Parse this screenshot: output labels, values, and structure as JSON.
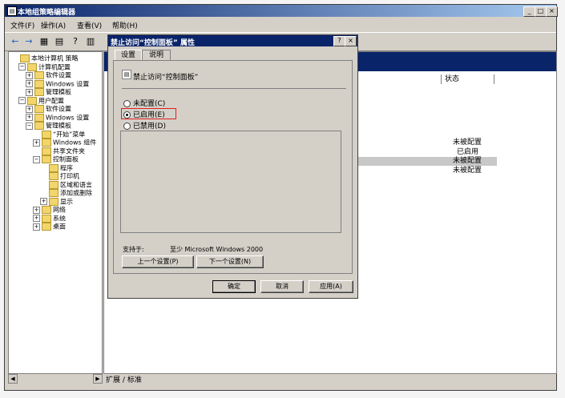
{
  "window": {
    "title": "本地组策略编辑器",
    "controls": [
      "_",
      "□",
      "×"
    ]
  },
  "menu": [
    "文件(F)",
    "操作(A)",
    "查看(V)",
    "帮助(H)"
  ],
  "toolbar": [
    "←",
    "→",
    "▦",
    "▤",
    "?",
    "▥"
  ],
  "tree": [
    {
      "label": "本地计算机 策略",
      "indent": 0,
      "exp": ""
    },
    {
      "label": "计算机配置",
      "indent": 1,
      "exp": "−"
    },
    {
      "label": "软件设置",
      "indent": 2,
      "exp": "+"
    },
    {
      "label": "Windows 设置",
      "indent": 2,
      "exp": "+"
    },
    {
      "label": "管理模板",
      "indent": 2,
      "exp": "+"
    },
    {
      "label": "用户配置",
      "indent": 1,
      "exp": "−"
    },
    {
      "label": "软件设置",
      "indent": 2,
      "exp": "+"
    },
    {
      "label": "Windows 设置",
      "indent": 2,
      "exp": "+"
    },
    {
      "label": "管理模板",
      "indent": 2,
      "exp": "−"
    },
    {
      "label": "“开始”菜单",
      "indent": 3,
      "exp": ""
    },
    {
      "label": "Windows 组件",
      "indent": 3,
      "exp": "+"
    },
    {
      "label": "共享文件夹",
      "indent": 3,
      "exp": ""
    },
    {
      "label": "控制面板",
      "indent": 3,
      "exp": "−"
    },
    {
      "label": "程序",
      "indent": 4,
      "exp": ""
    },
    {
      "label": "打印机",
      "indent": 4,
      "exp": ""
    },
    {
      "label": "区域和语言",
      "indent": 4,
      "exp": ""
    },
    {
      "label": "添加或删除",
      "indent": 4,
      "exp": ""
    },
    {
      "label": "显示",
      "indent": 4,
      "exp": "+"
    },
    {
      "label": "网络",
      "indent": 3,
      "exp": "+"
    },
    {
      "label": "系统",
      "indent": 3,
      "exp": "+"
    },
    {
      "label": "桌面",
      "indent": 3,
      "exp": "+"
    }
  ],
  "right": {
    "column_header": "状态",
    "statuses": [
      "未被配置",
      "已启用",
      "未被配置",
      "未被配置"
    ]
  },
  "bottom_tabs": {
    "extend": "扩展",
    "standard": "标准"
  },
  "dialog": {
    "title": "禁止访问“控制面板” 属性",
    "help_btn": "?",
    "close_btn": "×",
    "tab_settings": "设置",
    "tab_explain": "说明",
    "policy_name": "禁止访问“控制面板”",
    "opt_not_configured": "未配置(C)",
    "opt_enabled": "已启用(E)",
    "opt_disabled": "已禁用(D)",
    "supported_label": "支持于:",
    "supported_value": "至少 Microsoft Windows 2000",
    "prev_btn": "上一个设置(P)",
    "next_btn": "下一个设置(N)",
    "ok_btn": "确定",
    "cancel_btn": "取消",
    "apply_btn": "应用(A)"
  },
  "colors": {
    "titlebar": "#0a246a",
    "highlight": "#e02020"
  }
}
